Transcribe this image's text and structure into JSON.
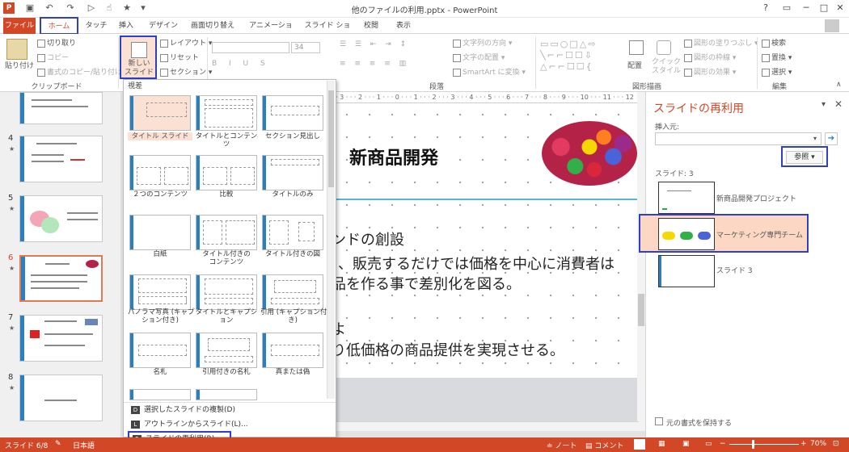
{
  "window": {
    "title": "他のファイルの利用.pptx - PowerPoint",
    "controls": [
      "?",
      "▭",
      "─",
      "□",
      "✕"
    ]
  },
  "tabs": [
    "ファイル",
    "ホーム",
    "タッチ",
    "挿入",
    "デザイン",
    "画面切り替え",
    "アニメーション",
    "スライド ショー",
    "校閲",
    "表示"
  ],
  "ribbon": {
    "clipboard": {
      "paste": "貼り付け",
      "cut": "切り取り",
      "copy": "コピー",
      "format_painter": "書式のコピー/貼り付け",
      "label": "クリップボード"
    },
    "slides": {
      "new_slide": "新しい\nスライド",
      "layout": "レイアウト",
      "reset": "リセット",
      "section": "セクション"
    },
    "font": {
      "size": "34"
    },
    "paragraph": {
      "text_direction": "文字列の方向",
      "align_text": "文字の配置",
      "smartart": "SmartArt に変換",
      "label": "段落"
    },
    "drawing": {
      "arrange": "配置",
      "quick_styles": "クイック\nスタイル",
      "fill": "図形の塗りつぶし",
      "outline": "図形の枠線",
      "effects": "図形の効果",
      "label": "図形描画"
    },
    "editing": {
      "find": "検索",
      "replace": "置換",
      "select": "選択",
      "label": "編集"
    }
  },
  "thumbnails": [
    {
      "num": "4",
      "star": "★"
    },
    {
      "num": "5",
      "star": "★"
    },
    {
      "num": "6",
      "star": "★"
    },
    {
      "num": "7",
      "star": "★"
    },
    {
      "num": "8",
      "star": "★"
    }
  ],
  "gallery": {
    "header": "視差",
    "layouts": [
      "タイトル スライド",
      "タイトルとコンテンツ",
      "セクション見出し",
      "２つのコンテンツ",
      "比較",
      "タイトルのみ",
      "白紙",
      "タイトル付きの\nコンテンツ",
      "タイトル付きの図",
      "パノラマ写真 (キャプ\nション付き)",
      "タイトルとキャプション",
      "引用 (キャプション付\nき)",
      "名札",
      "引用付きの名札",
      "真または偽"
    ],
    "menu": [
      {
        "key": "D",
        "label": "選択したスライドの複製(D)"
      },
      {
        "key": "L",
        "label": "アウトラインからスライド(L)..."
      },
      {
        "key": "R",
        "label": "スライドの再利用(R)..."
      }
    ]
  },
  "slide": {
    "title": "新商品開発",
    "lines": [
      "ンドの創設",
      "、販売するだけでは価格を中心に消費者は",
      "品を作る事で差別化を図る。",
      "よ",
      "り低価格の商品提供を実現させる。"
    ],
    "ruler": "· 3 · · · 2 · · · 1 · · · 0 · · · 1 · · · 2 · · · 3 · · · 4 · · · 5 · · · 6 · · · 7 · · · 8 · · · 9 · · · 10 · · · 11 · · · 12"
  },
  "reuse_pane": {
    "title": "スライドの再利用",
    "insert_from": "挿入元:",
    "browse": "参照",
    "count": "スライド: 3",
    "slides": [
      "新商品開発プロジェクト",
      "マーケティング専門チーム",
      "スライド 3"
    ],
    "keep_format": "元の書式を保持する"
  },
  "status": {
    "slide": "スライド 6/8",
    "lang": "日本語",
    "notes": "ノート",
    "comments": "コメント",
    "zoom": "70%"
  }
}
